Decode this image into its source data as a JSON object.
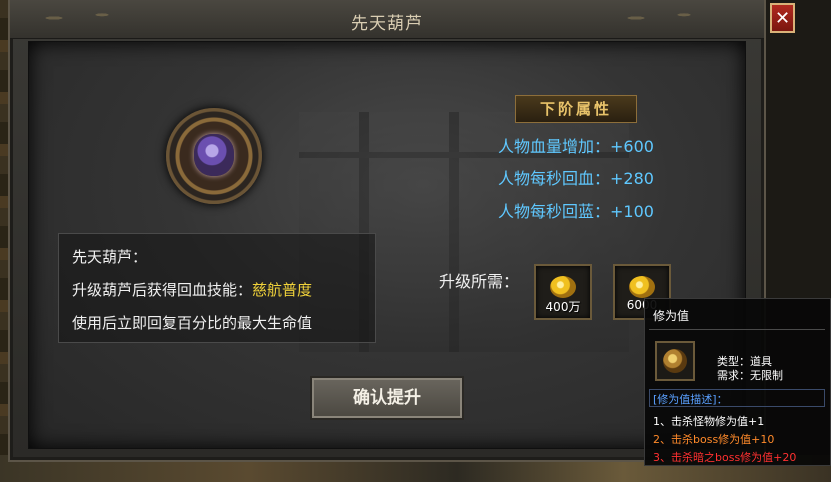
{
  "window": {
    "title": "先天葫芦",
    "close_label": "✕"
  },
  "next_attributes": {
    "header": "下阶属性",
    "items": [
      {
        "text": "人物血量增加：+600"
      },
      {
        "text": "人物每秒回血：+280"
      },
      {
        "text": "人物每秒回蓝：+100"
      }
    ]
  },
  "description": {
    "name": "先天葫芦：",
    "line2_prefix": "升级葫芦后获得回血技能：",
    "line2_skill": "慈航普度",
    "line3": "使用后立即回复百分比的最大生命值"
  },
  "requirements": {
    "label": "升级所需：",
    "items": [
      {
        "name": "gold-icon",
        "amount": "400万"
      },
      {
        "name": "cultivation-orb-icon",
        "amount": "6000"
      }
    ]
  },
  "confirm_button": "确认提升",
  "tooltip": {
    "title": "修为值",
    "type": "类型：道具",
    "need": "需求：无限制",
    "section": "[修为值描述]：",
    "lines": [
      {
        "text": "1、击杀怪物修为值+1",
        "color": "#ffffff"
      },
      {
        "text": "2、击杀boss修为值+10",
        "color": "#ff8a2a"
      },
      {
        "text": "3、击杀暗之boss修为值+20",
        "color": "#ff3030"
      }
    ]
  }
}
